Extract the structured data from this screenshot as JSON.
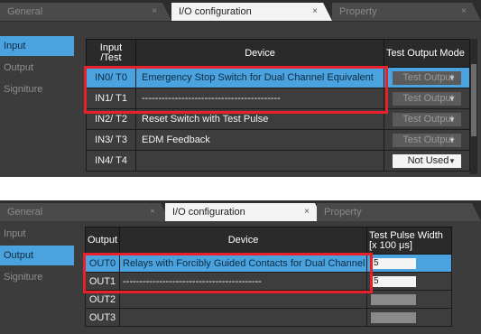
{
  "tabs": {
    "general": "General",
    "io": "I/O configuration",
    "property": "Property",
    "close": "×"
  },
  "side": {
    "input": "Input",
    "output": "Output",
    "signiture": "Signiture"
  },
  "input_table": {
    "headers": {
      "input": "Input\n/Test",
      "device": "Device",
      "mode": "Test Output Mode"
    },
    "rows": [
      {
        "id": "IN0/ T0",
        "device": "Emergency Stop Switch for Dual Channel Equivalent",
        "mode": "Test Output"
      },
      {
        "id": "IN1/ T1",
        "device": "------------------------------------------",
        "mode": "Test Output"
      },
      {
        "id": "IN2/ T2",
        "device": "Reset Switch with Test Pulse",
        "mode": "Test Output"
      },
      {
        "id": "IN3/ T3",
        "device": "EDM Feedback",
        "mode": "Test Output"
      },
      {
        "id": "IN4/ T4",
        "device": "",
        "mode": "Not Used"
      }
    ]
  },
  "output_table": {
    "headers": {
      "output": "Output",
      "device": "Device",
      "pulse": "Test Pulse Width\n[x 100 μs]"
    },
    "rows": [
      {
        "id": "OUT0",
        "device": "Relays with Forcibly Guided Contacts for Dual Channel",
        "pulse": "5"
      },
      {
        "id": "OUT1",
        "device": "------------------------------------------",
        "pulse": "5"
      },
      {
        "id": "OUT2",
        "device": "",
        "pulse": ""
      },
      {
        "id": "OUT3",
        "device": "",
        "pulse": ""
      }
    ]
  },
  "colors": {
    "accent": "#4aa3df",
    "highlight_box": "#e8202a",
    "panel": "#3c3c3c"
  }
}
